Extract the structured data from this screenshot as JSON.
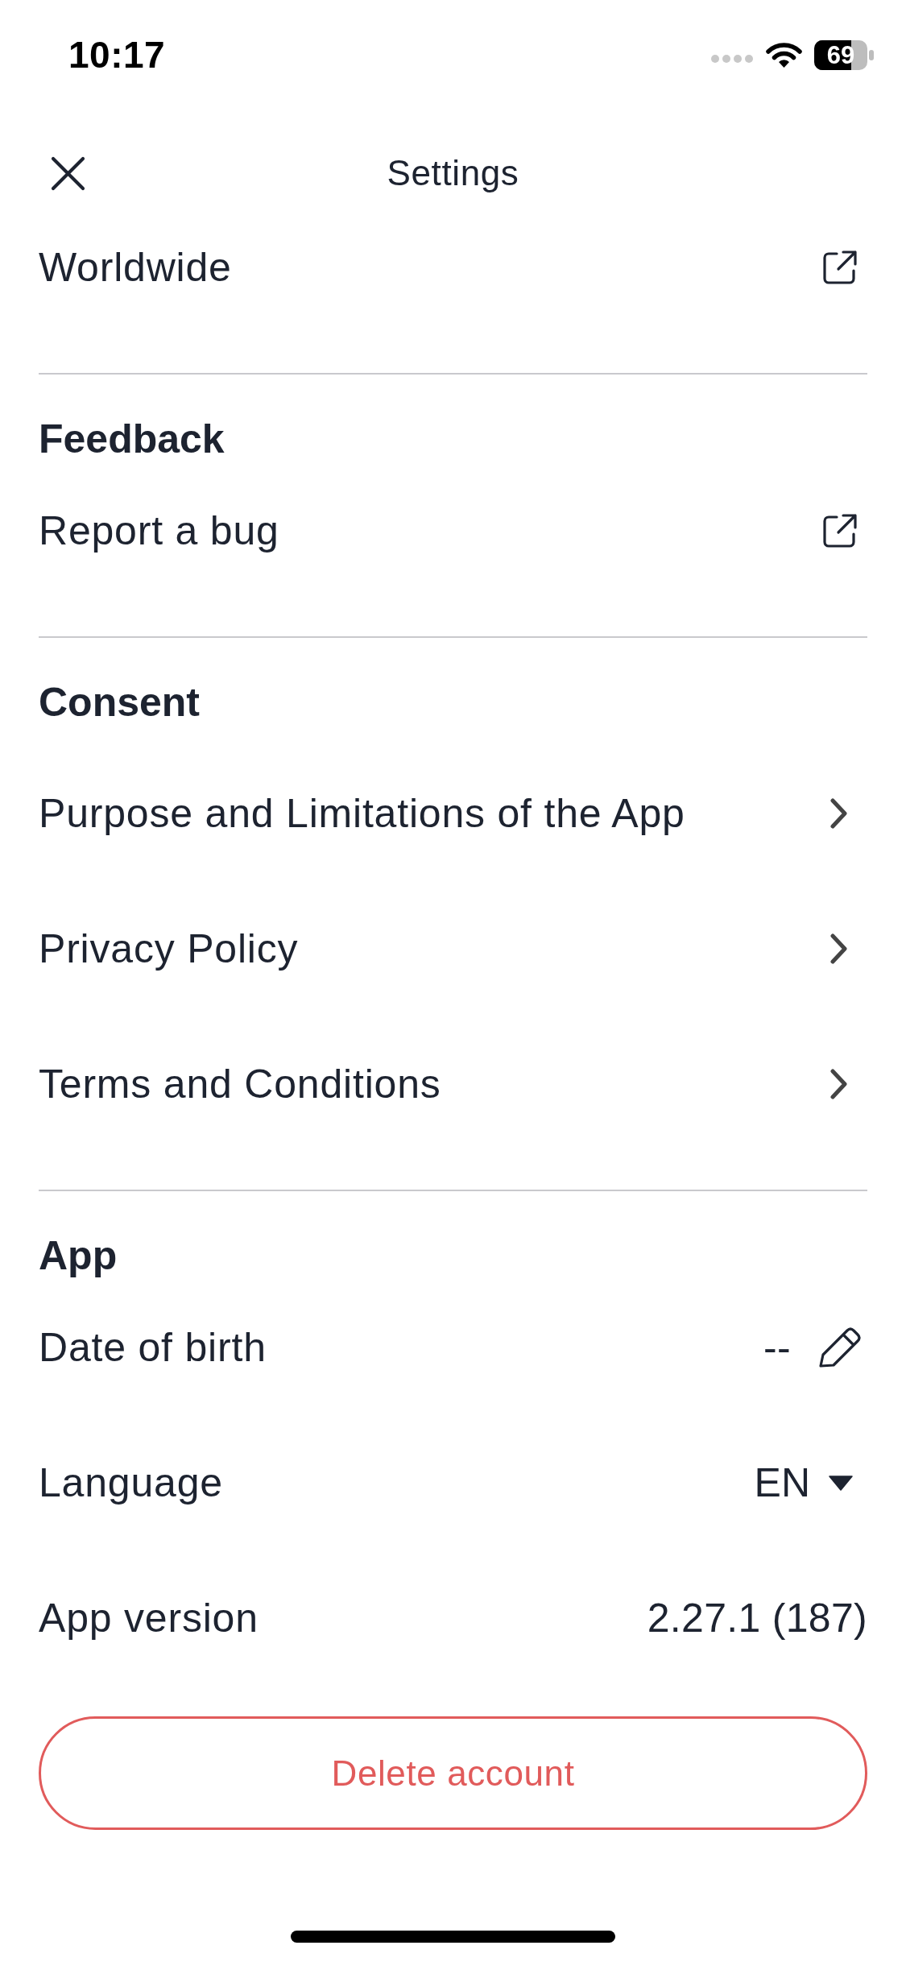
{
  "status_bar": {
    "time": "10:17",
    "battery": "69"
  },
  "header": {
    "title": "Settings"
  },
  "sections": [
    {
      "items": [
        {
          "kind": "external",
          "label": "Worldwide"
        }
      ]
    },
    {
      "heading": "Feedback",
      "items": [
        {
          "kind": "external",
          "label": "Report a bug"
        }
      ]
    },
    {
      "heading": "Consent",
      "items": [
        {
          "kind": "link",
          "label": "Purpose and Limitations of the App"
        },
        {
          "kind": "link",
          "label": "Privacy Policy"
        },
        {
          "kind": "link",
          "label": "Terms and Conditions"
        }
      ]
    },
    {
      "heading": "App",
      "items": [
        {
          "kind": "edit",
          "label": "Date of birth",
          "value": "--"
        },
        {
          "kind": "dropdown",
          "label": "Language",
          "value": "EN"
        },
        {
          "kind": "info",
          "label": "App version",
          "value": "2.27.1 (187)"
        }
      ]
    }
  ],
  "delete_button": {
    "label": "Delete account"
  }
}
